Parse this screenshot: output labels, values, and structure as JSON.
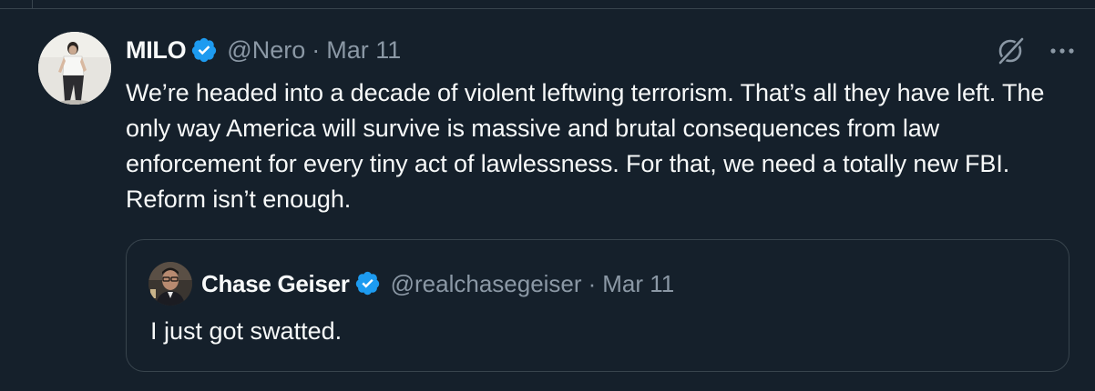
{
  "tweet": {
    "author_name": "MILO",
    "author_handle": "@Nero",
    "separator": "·",
    "date": "Mar 11",
    "text": "We’re headed into a decade of violent leftwing terrorism. That’s all they have left. The only way America will survive is massive and brutal consequences from law enforcement for every tiny act of lawlessness. For that, we need a totally new FBI. Reform isn’t enough.",
    "verified_icon": "verified-badge-icon",
    "grok_icon": "grok-icon",
    "more_icon": "more-options-icon"
  },
  "quoted_tweet": {
    "author_name": "Chase Geiser",
    "author_handle": "@realchasegeiser",
    "separator": "·",
    "date": "Mar 11",
    "text": "I just got swatted.",
    "verified_icon": "verified-badge-icon"
  },
  "colors": {
    "background": "#15202b",
    "border": "#38444d",
    "primary_text": "#f7f9f9",
    "secondary_text": "#8b98a5",
    "verified_blue": "#1d9bf0"
  }
}
